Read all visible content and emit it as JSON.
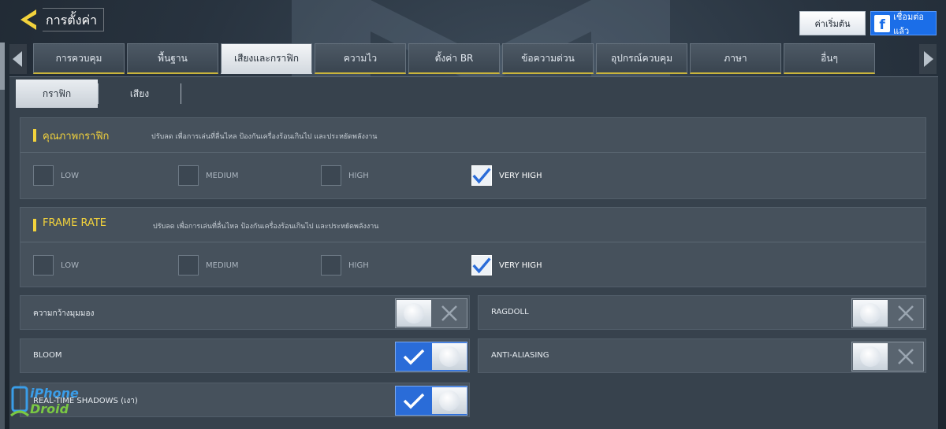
{
  "header": {
    "title": "การตั้งค่า",
    "reset_label": "ค่าเริ่มต้น",
    "facebook_label": "เชื่อมต่อแล้ว"
  },
  "tabs": [
    {
      "label": "การควบคุม",
      "active": false
    },
    {
      "label": "พื้นฐาน",
      "active": false
    },
    {
      "label": "เสียงและกราฟิก",
      "active": true
    },
    {
      "label": "ความไว",
      "active": false
    },
    {
      "label": "ตั้งค่า BR",
      "active": false
    },
    {
      "label": "ข้อความด่วน",
      "active": false
    },
    {
      "label": "อุปกรณ์ควบคุม",
      "active": false
    },
    {
      "label": "ภาษา",
      "active": false
    },
    {
      "label": "อื่นๆ",
      "active": false
    }
  ],
  "subtabs": [
    {
      "label": "กราฟิก",
      "active": true
    },
    {
      "label": "เสียง",
      "active": false
    }
  ],
  "graphics_quality": {
    "title": "คุณภาพกราฟิก",
    "description": "ปรับลด เพื่อการเล่นที่ลื่นไหล ป้องกันเครื่องร้อนเกินไป และประหยัดพลังงาน",
    "options": [
      "LOW",
      "MEDIUM",
      "HIGH",
      "VERY HIGH"
    ],
    "selected": "VERY HIGH"
  },
  "frame_rate": {
    "title": "FRAME RATE",
    "description": "ปรับลด เพื่อการเล่นที่ลื่นไหล ป้องกันเครื่องร้อนเกินไป และประหยัดพลังงาน",
    "options": [
      "LOW",
      "MEDIUM",
      "HIGH",
      "VERY HIGH"
    ],
    "selected": "VERY HIGH"
  },
  "toggles": [
    {
      "label": "ความกว้างมุมมอง",
      "on": false
    },
    {
      "label": "RAGDOLL",
      "on": false
    },
    {
      "label": "BLOOM",
      "on": true
    },
    {
      "label": "ANTI-ALIASING",
      "on": false
    },
    {
      "label": "REAL-TIME SHADOWS (เงา)",
      "on": true
    }
  ],
  "watermark": {
    "line1": "iPhone",
    "line2": "Droid"
  },
  "colors": {
    "accent_yellow": "#f2d23c",
    "toggle_on": "#2a6cd8",
    "facebook_blue": "#1b6ee8"
  }
}
